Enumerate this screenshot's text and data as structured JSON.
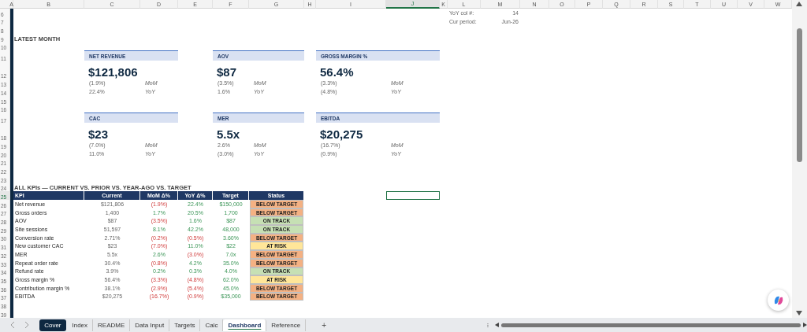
{
  "columns": [
    {
      "label": "A",
      "selected": false
    },
    {
      "label": "B",
      "selected": false
    },
    {
      "label": "C",
      "selected": false
    },
    {
      "label": "D",
      "selected": false
    },
    {
      "label": "E",
      "selected": false
    },
    {
      "label": "F",
      "selected": false
    },
    {
      "label": "G",
      "selected": false
    },
    {
      "label": "H",
      "selected": false
    },
    {
      "label": "I",
      "selected": false
    },
    {
      "label": "J",
      "selected": true
    },
    {
      "label": "K",
      "selected": false
    },
    {
      "label": "L",
      "selected": false
    },
    {
      "label": "M",
      "selected": false
    },
    {
      "label": "N",
      "selected": false
    },
    {
      "label": "O",
      "selected": false
    },
    {
      "label": "P",
      "selected": false
    },
    {
      "label": "Q",
      "selected": false
    },
    {
      "label": "R",
      "selected": false
    },
    {
      "label": "S",
      "selected": false
    },
    {
      "label": "T",
      "selected": false
    },
    {
      "label": "U",
      "selected": false
    },
    {
      "label": "V",
      "selected": false
    },
    {
      "label": "W",
      "selected": false
    }
  ],
  "rows": [
    {
      "label": "6",
      "selected": false
    },
    {
      "label": "7",
      "selected": false
    },
    {
      "label": "8",
      "selected": false
    },
    {
      "label": "9",
      "selected": false
    },
    {
      "label": "10",
      "selected": false
    },
    {
      "label": "11",
      "selected": false
    },
    {
      "label": "12",
      "selected": false
    },
    {
      "label": "13",
      "selected": false
    },
    {
      "label": "14",
      "selected": false
    },
    {
      "label": "15",
      "selected": false
    },
    {
      "label": "16",
      "selected": false
    },
    {
      "label": "17",
      "selected": false
    },
    {
      "label": "18",
      "selected": false
    },
    {
      "label": "19",
      "selected": false
    },
    {
      "label": "20",
      "selected": false
    },
    {
      "label": "21",
      "selected": false
    },
    {
      "label": "22",
      "selected": false
    },
    {
      "label": "23",
      "selected": false
    },
    {
      "label": "24",
      "selected": false
    },
    {
      "label": "25",
      "selected": true
    },
    {
      "label": "26",
      "selected": false
    },
    {
      "label": "27",
      "selected": false
    },
    {
      "label": "28",
      "selected": false
    },
    {
      "label": "29",
      "selected": false
    },
    {
      "label": "30",
      "selected": false
    },
    {
      "label": "31",
      "selected": false
    },
    {
      "label": "32",
      "selected": false
    },
    {
      "label": "33",
      "selected": false
    },
    {
      "label": "34",
      "selected": false
    },
    {
      "label": "35",
      "selected": false
    },
    {
      "label": "36",
      "selected": false
    },
    {
      "label": "37",
      "selected": false
    },
    {
      "label": "38",
      "selected": false
    },
    {
      "label": "39",
      "selected": false
    }
  ],
  "params": [
    {
      "label": "YoY col #:",
      "value": "14"
    },
    {
      "label": "Cur period:",
      "value": "Jun-26"
    }
  ],
  "latest_month": {
    "title": "LATEST MONTH",
    "cards": [
      {
        "label": "NET REVENUE",
        "value": "$121,806",
        "mom": "(1.9%)",
        "mom_label": "MoM",
        "yoy": "22.4%",
        "yoy_label": "YoY"
      },
      {
        "label": "AOV",
        "value": "$87",
        "mom": "(3.5%)",
        "mom_label": "MoM",
        "yoy": "1.6%",
        "yoy_label": "YoY"
      },
      {
        "label": "GROSS MARGIN %",
        "value": "56.4%",
        "mom": "(3.3%)",
        "mom_label": "MoM",
        "yoy": "(4.8%)",
        "yoy_label": "YoY"
      },
      {
        "label": "CAC",
        "value": "$23",
        "mom": "(7.0%)",
        "mom_label": "MoM",
        "yoy": "11.0%",
        "yoy_label": "YoY"
      },
      {
        "label": "MER",
        "value": "5.5x",
        "mom": "2.6%",
        "mom_label": "MoM",
        "yoy": "(3.0%)",
        "yoy_label": "YoY"
      },
      {
        "label": "EBITDA",
        "value": "$20,275",
        "mom": "(16.7%)",
        "mom_label": "MoM",
        "yoy": "(0.9%)",
        "yoy_label": "YoY"
      }
    ]
  },
  "kpi_table": {
    "title": "ALL KPIs — CURRENT VS. PRIOR VS. YEAR-AGO VS. TARGET",
    "columns": [
      "KPI",
      "Current",
      "MoM Δ%",
      "YoY Δ%",
      "Target",
      "Status"
    ],
    "rows": [
      {
        "kpi": "Net revenue",
        "current": "$121,806",
        "mom": {
          "text": "(1.9%)",
          "kind": "decrease"
        },
        "yoy": {
          "text": "22.4%",
          "kind": "increase"
        },
        "target": "$150,000",
        "status": {
          "text": "BELOW TARGET",
          "kind": "below"
        }
      },
      {
        "kpi": "Gross orders",
        "current": "1,400",
        "mom": {
          "text": "1.7%",
          "kind": "increase"
        },
        "yoy": {
          "text": "20.5%",
          "kind": "increase"
        },
        "target": "1,700",
        "status": {
          "text": "BELOW TARGET",
          "kind": "below"
        }
      },
      {
        "kpi": "AOV",
        "current": "$87",
        "mom": {
          "text": "(3.5%)",
          "kind": "decrease"
        },
        "yoy": {
          "text": "1.6%",
          "kind": "increase"
        },
        "target": "$87",
        "status": {
          "text": "ON TRACK",
          "kind": "on_track"
        }
      },
      {
        "kpi": "Site sessions",
        "current": "51,597",
        "mom": {
          "text": "8.1%",
          "kind": "increase"
        },
        "yoy": {
          "text": "42.2%",
          "kind": "increase"
        },
        "target": "48,000",
        "status": {
          "text": "ON TRACK",
          "kind": "on_track"
        }
      },
      {
        "kpi": "Conversion rate",
        "current": "2.71%",
        "mom": {
          "text": "(0.2%)",
          "kind": "decrease"
        },
        "yoy": {
          "text": "(0.5%)",
          "kind": "decrease"
        },
        "target": "3.60%",
        "status": {
          "text": "BELOW TARGET",
          "kind": "below"
        }
      },
      {
        "kpi": "New customer CAC",
        "current": "$23",
        "mom": {
          "text": "(7.0%)",
          "kind": "decrease"
        },
        "yoy": {
          "text": "11.0%",
          "kind": "increase"
        },
        "target": "$22",
        "status": {
          "text": "AT RISK",
          "kind": "at_risk"
        }
      },
      {
        "kpi": "MER",
        "current": "5.5x",
        "mom": {
          "text": "2.6%",
          "kind": "increase"
        },
        "yoy": {
          "text": "(3.0%)",
          "kind": "decrease"
        },
        "target": "7.0x",
        "status": {
          "text": "BELOW TARGET",
          "kind": "below"
        }
      },
      {
        "kpi": "Repeat order rate",
        "current": "30.4%",
        "mom": {
          "text": "(0.8%)",
          "kind": "decrease"
        },
        "yoy": {
          "text": "4.2%",
          "kind": "increase"
        },
        "target": "35.0%",
        "status": {
          "text": "BELOW TARGET",
          "kind": "below"
        }
      },
      {
        "kpi": "Refund rate",
        "current": "3.9%",
        "mom": {
          "text": "0.2%",
          "kind": "increase"
        },
        "yoy": {
          "text": "0.3%",
          "kind": "increase"
        },
        "target": "4.0%",
        "status": {
          "text": "ON TRACK",
          "kind": "on_track"
        }
      },
      {
        "kpi": "Gross margin %",
        "current": "56.4%",
        "mom": {
          "text": "(3.3%)",
          "kind": "decrease"
        },
        "yoy": {
          "text": "(4.8%)",
          "kind": "decrease"
        },
        "target": "62.0%",
        "status": {
          "text": "AT RISK",
          "kind": "at_risk"
        }
      },
      {
        "kpi": "Contribution margin %",
        "current": "38.1%",
        "mom": {
          "text": "(2.9%)",
          "kind": "decrease"
        },
        "yoy": {
          "text": "(5.4%)",
          "kind": "decrease"
        },
        "target": "45.0%",
        "status": {
          "text": "BELOW TARGET",
          "kind": "below"
        }
      },
      {
        "kpi": "EBITDA",
        "current": "$20,275",
        "mom": {
          "text": "(16.7%)",
          "kind": "decrease"
        },
        "yoy": {
          "text": "(0.9%)",
          "kind": "decrease"
        },
        "target": "$35,000",
        "status": {
          "text": "BELOW TARGET",
          "kind": "below"
        }
      }
    ]
  },
  "sheet_tabs": [
    {
      "label": "Cover",
      "selected": false,
      "color": "#0e2841"
    },
    {
      "label": "Index",
      "selected": false
    },
    {
      "label": "README",
      "selected": false
    },
    {
      "label": "Data Input",
      "selected": false
    },
    {
      "label": "Targets",
      "selected": false
    },
    {
      "label": "Calc",
      "selected": false
    },
    {
      "label": "Dashboard",
      "selected": true
    },
    {
      "label": "Reference",
      "selected": false
    }
  ],
  "add_sheet": "+"
}
